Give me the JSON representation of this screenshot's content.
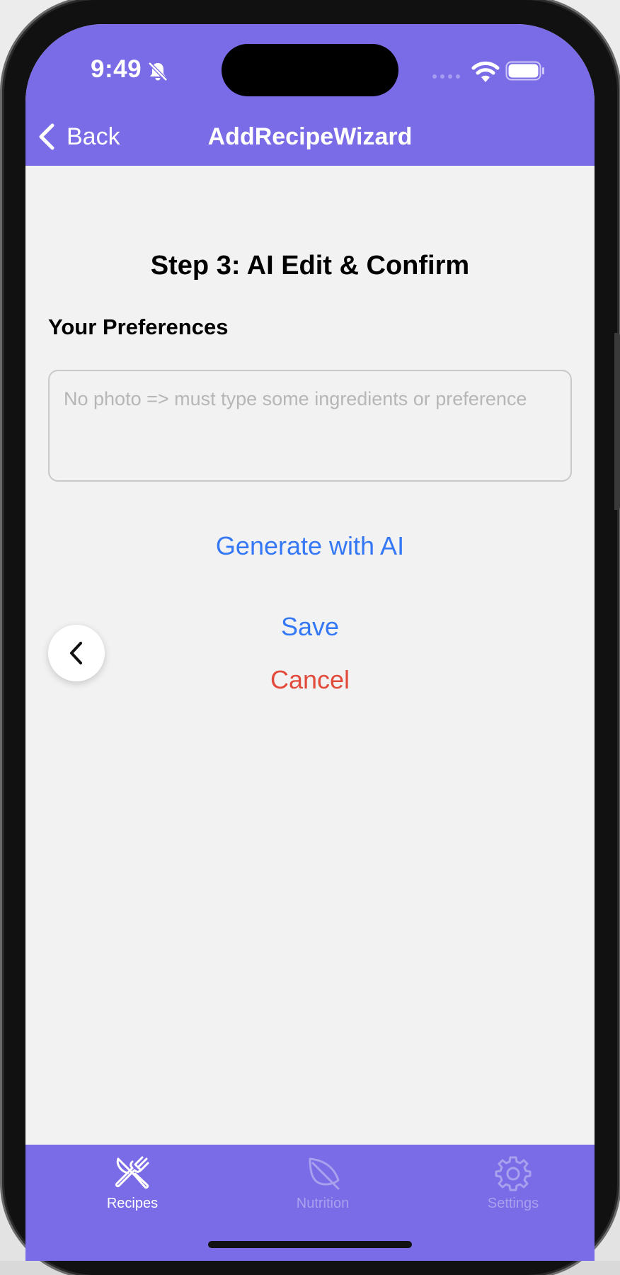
{
  "status_bar": {
    "time": "9:49",
    "icons": [
      "bell-slash-icon",
      "cellular-signal-icon",
      "wifi-icon",
      "battery-icon"
    ]
  },
  "nav": {
    "back_label": "Back",
    "title": "AddRecipeWizard"
  },
  "content": {
    "step_title": "Step 3: AI Edit & Confirm",
    "preferences_label": "Your Preferences",
    "preferences_value": "",
    "preferences_placeholder": "No photo => must type some ingredients or preference",
    "generate_label": "Generate with AI",
    "save_label": "Save",
    "cancel_label": "Cancel"
  },
  "tabs": [
    {
      "label": "Recipes",
      "icon": "fork-knife-icon",
      "active": true
    },
    {
      "label": "Nutrition",
      "icon": "leaf-icon",
      "active": false
    },
    {
      "label": "Settings",
      "icon": "gear-icon",
      "active": false
    }
  ],
  "colors": {
    "accent": "#7a6be6",
    "link": "#3478f6",
    "destructive": "#e24a3c",
    "background": "#f2f2f2",
    "tab_inactive": "#a9a0ee"
  }
}
